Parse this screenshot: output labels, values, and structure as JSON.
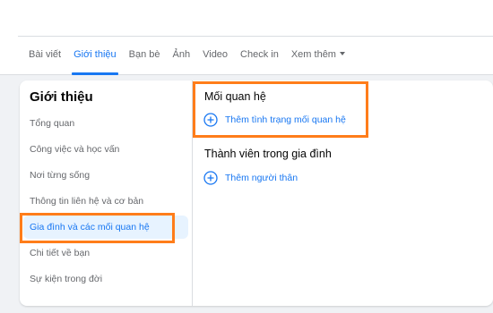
{
  "tabs": [
    {
      "label": "Bài viết"
    },
    {
      "label": "Giới thiệu",
      "active": true
    },
    {
      "label": "Bạn bè"
    },
    {
      "label": "Ảnh"
    },
    {
      "label": "Video"
    },
    {
      "label": "Check in"
    },
    {
      "label": "Xem thêm"
    }
  ],
  "about": {
    "title": "Giới thiệu",
    "menu": [
      {
        "label": "Tổng quan"
      },
      {
        "label": "Công việc và học vấn"
      },
      {
        "label": "Nơi từng sống"
      },
      {
        "label": "Thông tin liên hệ và cơ bản"
      },
      {
        "label": "Gia đình và các mối quan hệ",
        "active": true
      },
      {
        "label": "Chi tiết về bạn"
      },
      {
        "label": "Sự kiện trong đời"
      }
    ]
  },
  "relationship": {
    "title": "Mối quan hệ",
    "add_label": "Thêm tình trạng mối quan hệ"
  },
  "family": {
    "title": "Thành viên trong gia đình",
    "add_label": "Thêm người thân"
  },
  "colors": {
    "accent": "#1877f2",
    "highlight": "#ff7d1a"
  }
}
